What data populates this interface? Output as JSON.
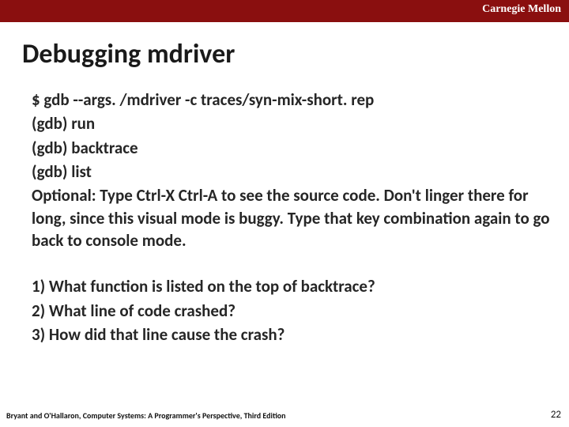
{
  "brand": "Carnegie Mellon",
  "title": "Debugging mdriver",
  "body": {
    "cmd": "$ gdb --args. /mdriver -c traces/syn-mix-short. rep",
    "run": "(gdb) run",
    "bt": "(gdb) backtrace",
    "list": "(gdb) list",
    "optional": "Optional: Type Ctrl-X Ctrl-A to see the source code. Don't linger there for long, since this visual mode is buggy. Type that key combination again to go back to console mode."
  },
  "questions": {
    "q1": "1) What function is listed on the top of backtrace?",
    "q2": "2) What line of code crashed?",
    "q3": "3) How did that line cause the crash?"
  },
  "footer": {
    "citation": "Bryant and O'Hallaron, Computer Systems: A Programmer's Perspective, Third Edition",
    "page": "22"
  }
}
